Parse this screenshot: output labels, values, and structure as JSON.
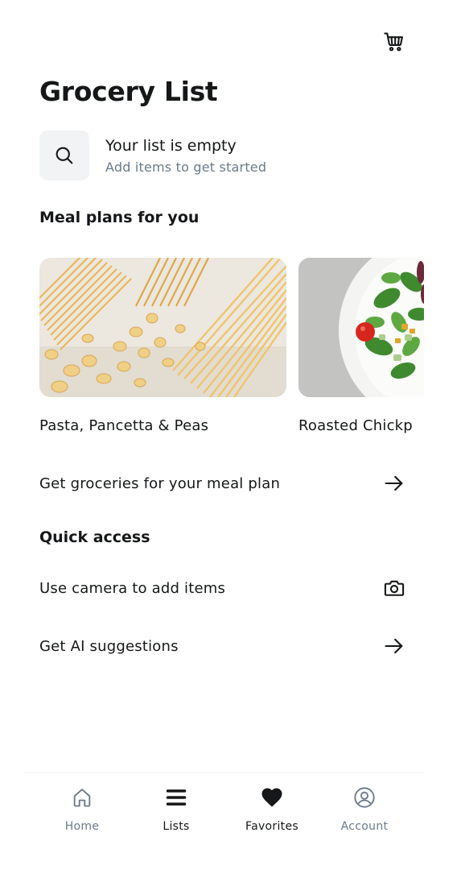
{
  "header": {
    "title": "Grocery List",
    "cart_icon": "cart-icon"
  },
  "empty_state": {
    "icon": "search-icon",
    "title": "Your list is empty",
    "subtitle": "Add items to get started"
  },
  "meal_plans": {
    "title": "Meal plans for you",
    "cards": [
      {
        "label": "Pasta, Pancetta & Peas",
        "image": "pasta-photo"
      },
      {
        "label": "Roasted Chickp",
        "image": "salad-photo"
      }
    ],
    "cta_label": "Get groceries for your meal plan",
    "cta_icon": "arrow-right-icon"
  },
  "quick_access": {
    "title": "Quick access",
    "items": [
      {
        "label": "Use camera to add items",
        "icon": "camera-icon"
      },
      {
        "label": "Get AI suggestions",
        "icon": "arrow-right-icon"
      }
    ]
  },
  "tabbar": {
    "tabs": [
      {
        "label": "Home",
        "icon": "home-icon",
        "active": false
      },
      {
        "label": "Lists",
        "icon": "menu-icon",
        "active": true
      },
      {
        "label": "Favorites",
        "icon": "heart-icon",
        "active": true
      },
      {
        "label": "Account",
        "icon": "user-circle-icon",
        "active": false
      }
    ]
  },
  "colors": {
    "text": "#151718",
    "muted": "#6a7a8c",
    "search_bg": "#f1f3f5"
  }
}
